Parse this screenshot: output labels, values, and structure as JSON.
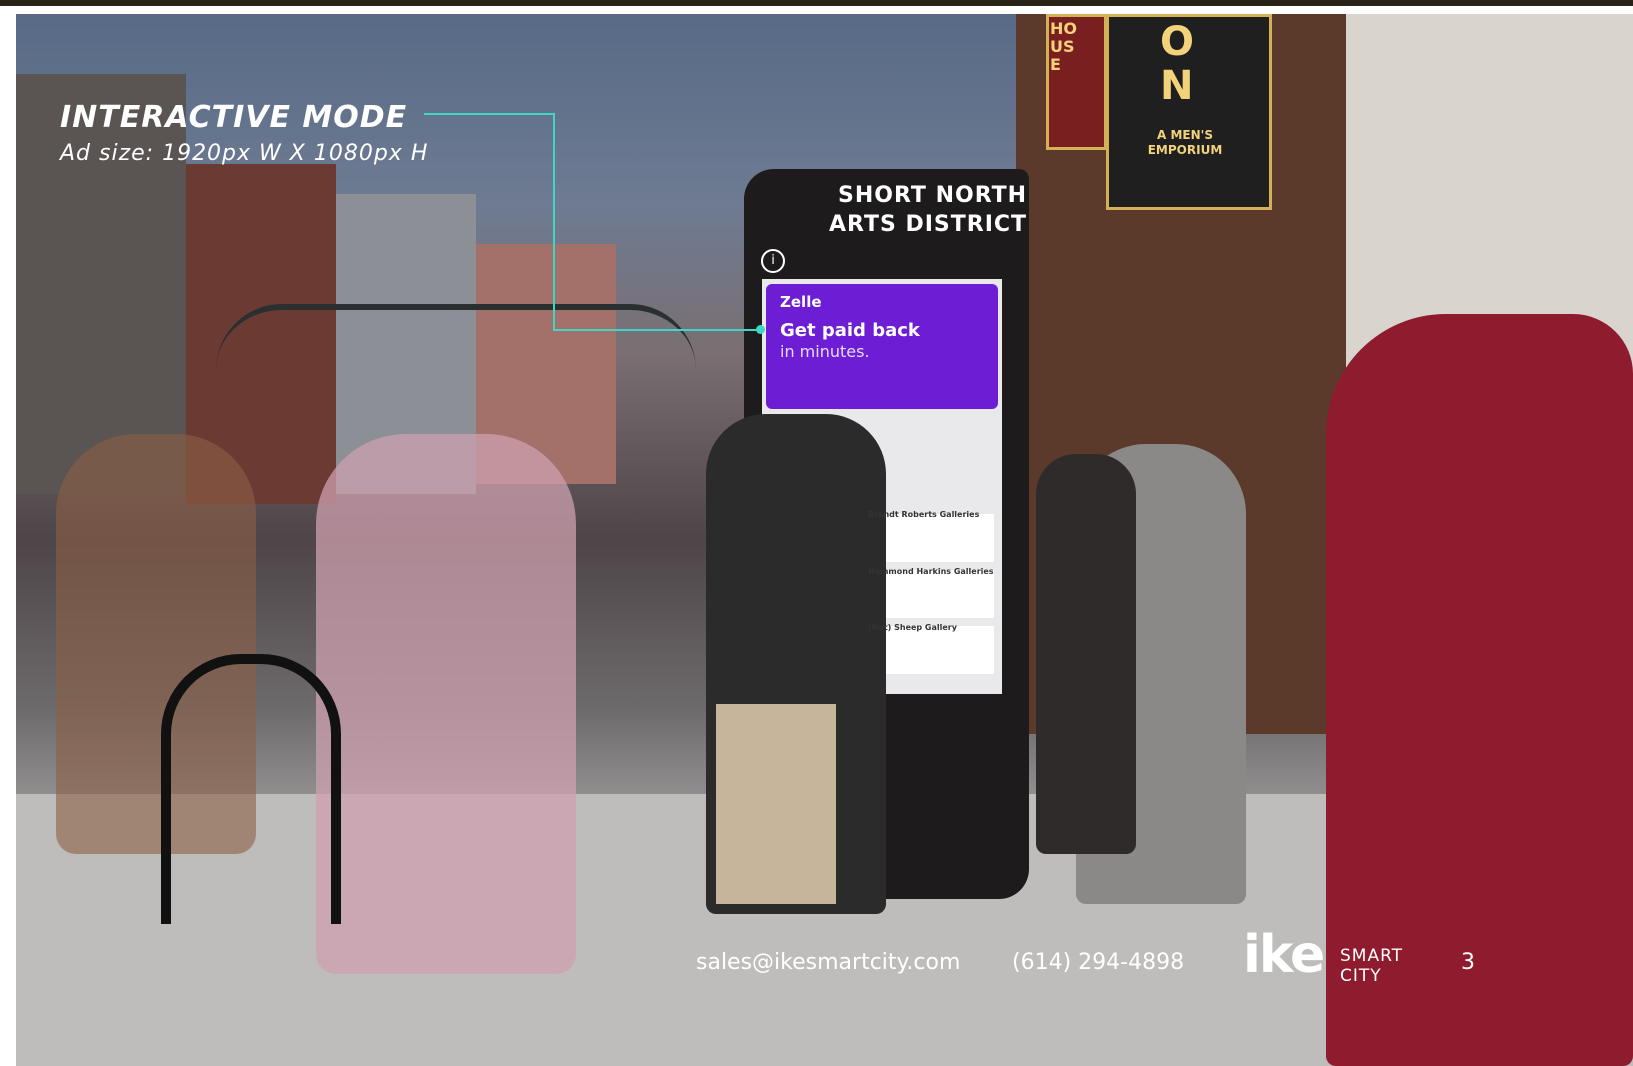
{
  "overlay": {
    "title": "INTERACTIVE MODE",
    "subtitle": "Ad size: 1920px W X 1080px H"
  },
  "kiosk": {
    "header_line1": "SHORT NORTH",
    "header_line2": "ARTS DISTRICT",
    "ad": {
      "brand": "Zelle",
      "headline": "Get paid back",
      "subline": "in minutes."
    },
    "list_items": [
      "Brandt Roberts Galleries",
      "Hammond Harkins Galleries",
      "(Not) Sheep Gallery"
    ]
  },
  "storefront_signs": [
    "HOUSE",
    "ON",
    "A MEN'S EMPORIUM"
  ],
  "footer": {
    "email": "sales@ikesmartcity.com",
    "phone": "(614) 294-4898",
    "logo_main": "ike",
    "logo_sub1": "SMART",
    "logo_sub2": "CITY",
    "page_number": "3"
  },
  "colors": {
    "accent_teal": "#3fd6c6",
    "zelle_purple": "#6d1ed4",
    "kiosk_body": "#1d1b1c"
  }
}
